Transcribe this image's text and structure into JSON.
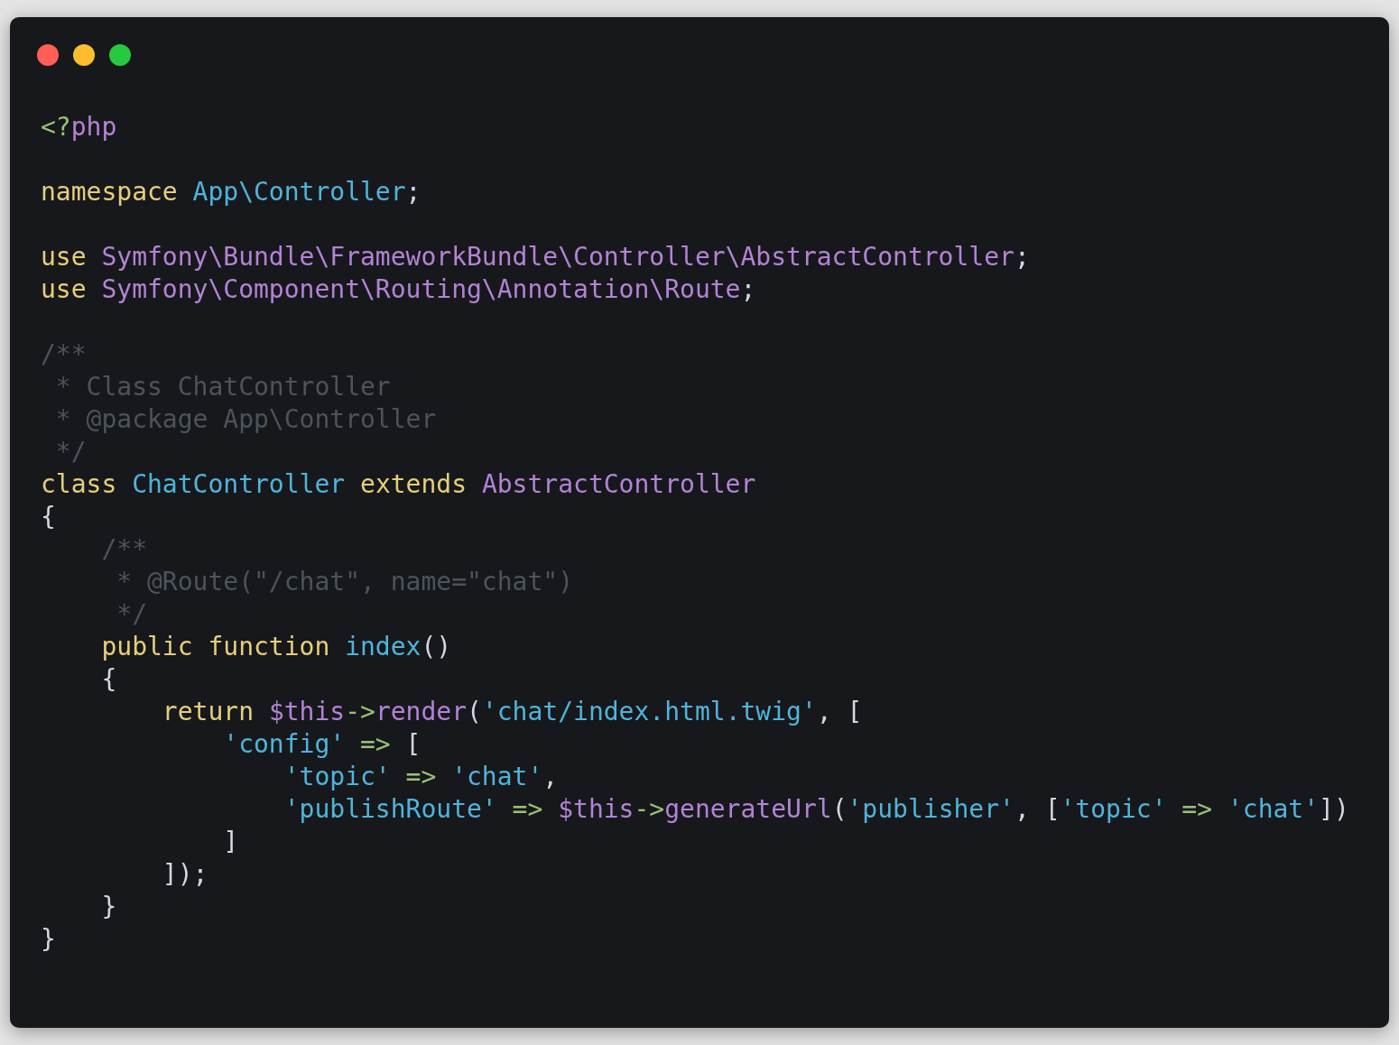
{
  "window": {
    "controls": [
      {
        "kind": "close"
      },
      {
        "kind": "minimize"
      },
      {
        "kind": "zoom"
      }
    ]
  },
  "code": {
    "lines": [
      {
        "kind": "code",
        "tokens": [
          {
            "kind": "tag",
            "text": "<?"
          },
          {
            "kind": "name",
            "text": "php"
          }
        ]
      },
      {
        "kind": "blank"
      },
      {
        "kind": "code",
        "tokens": [
          {
            "kind": "keyword",
            "text": "namespace "
          },
          {
            "kind": "type",
            "text": "App\\Controller"
          },
          {
            "kind": "plain",
            "text": ";"
          }
        ]
      },
      {
        "kind": "blank"
      },
      {
        "kind": "code",
        "tokens": [
          {
            "kind": "keyword",
            "text": "use "
          },
          {
            "kind": "name",
            "text": "Symfony\\Bundle\\FrameworkBundle\\Controller\\AbstractController"
          },
          {
            "kind": "plain",
            "text": ";"
          }
        ]
      },
      {
        "kind": "code",
        "tokens": [
          {
            "kind": "keyword",
            "text": "use "
          },
          {
            "kind": "name",
            "text": "Symfony\\Component\\Routing\\Annotation\\Route"
          },
          {
            "kind": "plain",
            "text": ";"
          }
        ]
      },
      {
        "kind": "blank"
      },
      {
        "kind": "code",
        "tokens": [
          {
            "kind": "comment",
            "text": "/**"
          }
        ]
      },
      {
        "kind": "code",
        "tokens": [
          {
            "kind": "comment",
            "text": " * Class ChatController"
          }
        ]
      },
      {
        "kind": "code",
        "tokens": [
          {
            "kind": "comment",
            "text": " * @package App\\Controller"
          }
        ]
      },
      {
        "kind": "code",
        "tokens": [
          {
            "kind": "comment",
            "text": " */"
          }
        ]
      },
      {
        "kind": "code",
        "tokens": [
          {
            "kind": "keyword",
            "text": "class "
          },
          {
            "kind": "type",
            "text": "ChatController "
          },
          {
            "kind": "keyword",
            "text": "extends "
          },
          {
            "kind": "name",
            "text": "AbstractController"
          }
        ]
      },
      {
        "kind": "code",
        "tokens": [
          {
            "kind": "plain",
            "text": "{"
          }
        ]
      },
      {
        "kind": "code",
        "tokens": [
          {
            "kind": "comment",
            "text": "    /**"
          }
        ]
      },
      {
        "kind": "code",
        "tokens": [
          {
            "kind": "comment",
            "text": "     * @Route(\"/chat\", name=\"chat\")"
          }
        ]
      },
      {
        "kind": "code",
        "tokens": [
          {
            "kind": "comment",
            "text": "     */"
          }
        ]
      },
      {
        "kind": "code",
        "tokens": [
          {
            "kind": "keyword",
            "text": "    public function "
          },
          {
            "kind": "type",
            "text": "index"
          },
          {
            "kind": "plain",
            "text": "()"
          }
        ]
      },
      {
        "kind": "code",
        "tokens": [
          {
            "kind": "plain",
            "text": "    {"
          }
        ]
      },
      {
        "kind": "code",
        "tokens": [
          {
            "kind": "keyword",
            "text": "        return "
          },
          {
            "kind": "name",
            "text": "$this"
          },
          {
            "kind": "operator",
            "text": "->"
          },
          {
            "kind": "name",
            "text": "render"
          },
          {
            "kind": "plain",
            "text": "("
          },
          {
            "kind": "string",
            "text": "'chat/index.html.twig'"
          },
          {
            "kind": "plain",
            "text": ", ["
          }
        ]
      },
      {
        "kind": "code",
        "tokens": [
          {
            "kind": "string",
            "text": "            'config' "
          },
          {
            "kind": "operator",
            "text": "=>"
          },
          {
            "kind": "plain",
            "text": " ["
          }
        ]
      },
      {
        "kind": "code",
        "tokens": [
          {
            "kind": "string",
            "text": "                'topic' "
          },
          {
            "kind": "operator",
            "text": "=> "
          },
          {
            "kind": "string",
            "text": "'chat'"
          },
          {
            "kind": "plain",
            "text": ","
          }
        ]
      },
      {
        "kind": "code",
        "tokens": [
          {
            "kind": "string",
            "text": "                'publishRoute' "
          },
          {
            "kind": "operator",
            "text": "=> "
          },
          {
            "kind": "name",
            "text": "$this"
          },
          {
            "kind": "operator",
            "text": "->"
          },
          {
            "kind": "name",
            "text": "generateUrl"
          },
          {
            "kind": "plain",
            "text": "("
          },
          {
            "kind": "string",
            "text": "'publisher'"
          },
          {
            "kind": "plain",
            "text": ", ["
          },
          {
            "kind": "string",
            "text": "'topic' "
          },
          {
            "kind": "operator",
            "text": "=> "
          },
          {
            "kind": "string",
            "text": "'chat'"
          },
          {
            "kind": "plain",
            "text": "])"
          }
        ]
      },
      {
        "kind": "code",
        "tokens": [
          {
            "kind": "plain",
            "text": "            ]"
          }
        ]
      },
      {
        "kind": "code",
        "tokens": [
          {
            "kind": "plain",
            "text": "        ]);"
          }
        ]
      },
      {
        "kind": "code",
        "tokens": [
          {
            "kind": "plain",
            "text": "    }"
          }
        ]
      },
      {
        "kind": "code",
        "tokens": [
          {
            "kind": "plain",
            "text": "}"
          }
        ]
      }
    ]
  }
}
